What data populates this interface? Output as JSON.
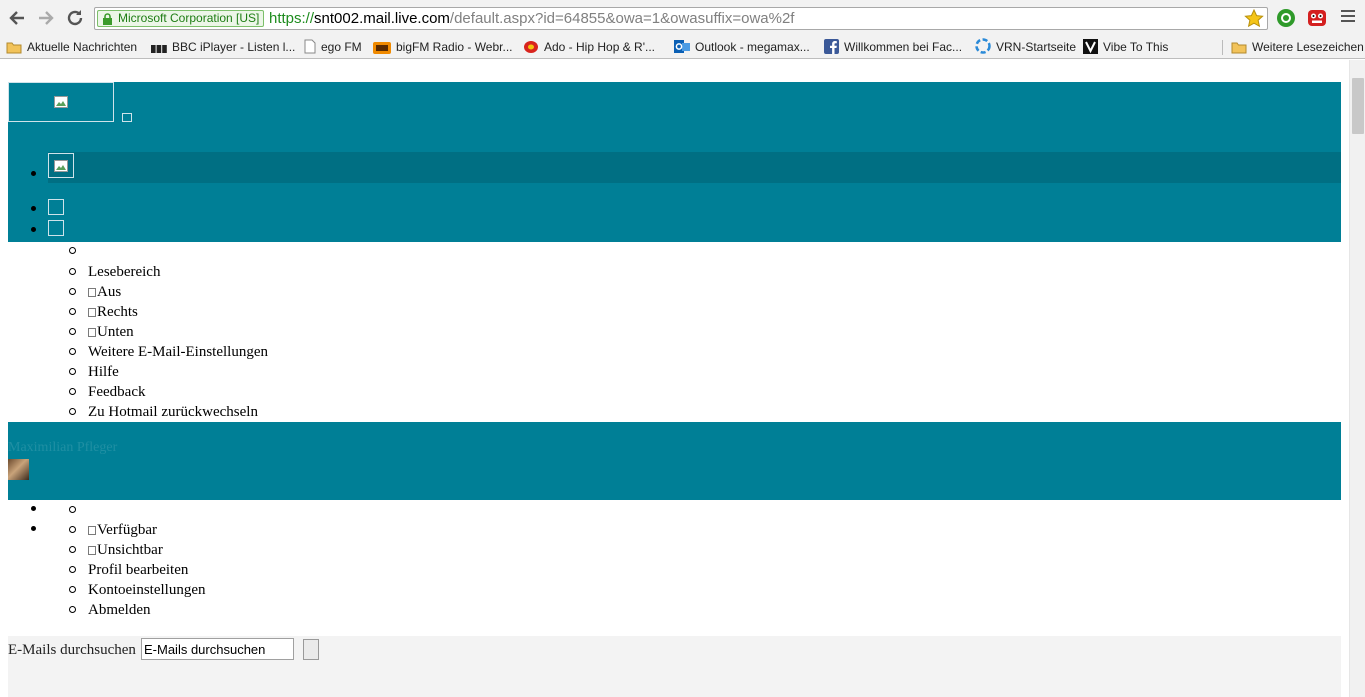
{
  "browser": {
    "ev_label": "Microsoft Corporation [US]",
    "url_scheme": "https://",
    "url_host": "snt002.mail.live.com",
    "url_path": "/default.aspx?id=64855&owa=1&owasuffix=owa%2f",
    "bookmarks": [
      {
        "label": "Aktuelle Nachrichten",
        "icon": "folder-icon"
      },
      {
        "label": "BBC iPlayer - Listen l...",
        "icon": "bbc-icon"
      },
      {
        "label": "ego FM",
        "icon": "page-icon"
      },
      {
        "label": "bigFM Radio - Webr...",
        "icon": "bigfm-icon"
      },
      {
        "label": "Ado - Hip Hop & R'...",
        "icon": "ado-icon"
      },
      {
        "label": "Outlook - megamax...",
        "icon": "outlook-icon"
      },
      {
        "label": "Willkommen bei Fac...",
        "icon": "facebook-icon"
      },
      {
        "label": "VRN-Startseite",
        "icon": "vrn-icon"
      },
      {
        "label": "Vibe To This",
        "icon": "vibe-icon"
      }
    ],
    "other_bookmarks": "Weitere Lesezeichen"
  },
  "options_menu": {
    "reading_pane": "Lesebereich",
    "off": "Aus",
    "right": "Rechts",
    "bottom": "Unten",
    "more_settings": "Weitere E-Mail-Einstellungen",
    "help": "Hilfe",
    "feedback": "Feedback",
    "switch_back": "Zu Hotmail zurückwechseln"
  },
  "user": {
    "name": "Maximilian Pfleger"
  },
  "status_menu": {
    "available": "Verfügbar",
    "invisible": "Unsichtbar",
    "edit_profile": "Profil bearbeiten",
    "account_settings": "Kontoeinstellungen",
    "sign_out": "Abmelden"
  },
  "search": {
    "label": "E-Mails durchsuchen",
    "value": "E-Mails durchsuchen"
  },
  "colors": {
    "header_teal": "#007f96",
    "selected_teal": "#006f83"
  }
}
